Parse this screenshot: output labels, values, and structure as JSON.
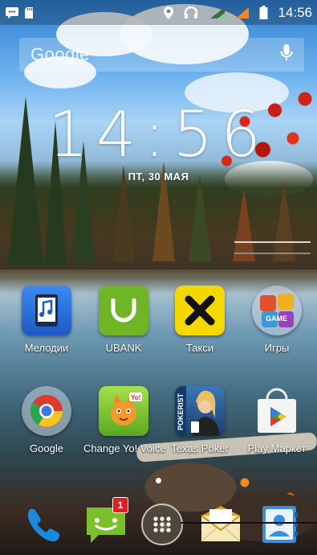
{
  "status": {
    "time": "14:56"
  },
  "search": {
    "brand": "Google"
  },
  "clock": {
    "time": "14:56",
    "date": "ПТ, 30 МАЯ"
  },
  "apps_row1": [
    {
      "label": "Мелодии",
      "icon": "music-phone-icon"
    },
    {
      "label": "UBANK",
      "icon": "ubank-icon"
    },
    {
      "label": "Такси",
      "icon": "taxi-icon"
    },
    {
      "label": "Игры",
      "icon": "games-icon"
    }
  ],
  "apps_row2": [
    {
      "label": "Google",
      "icon": "google-folder-icon"
    },
    {
      "label": "Change Yo! Voice",
      "icon": "change-voice-icon"
    },
    {
      "label": "Texas Poker",
      "icon": "poker-icon"
    },
    {
      "label": "Play Маркет",
      "icon": "play-store-icon"
    }
  ],
  "dock": {
    "messages_badge": "1"
  },
  "colors": {
    "ubank": "#6fb526",
    "taxi": "#f5d800",
    "melodii": "#2a6fd8",
    "accent_red": "#e02020"
  }
}
